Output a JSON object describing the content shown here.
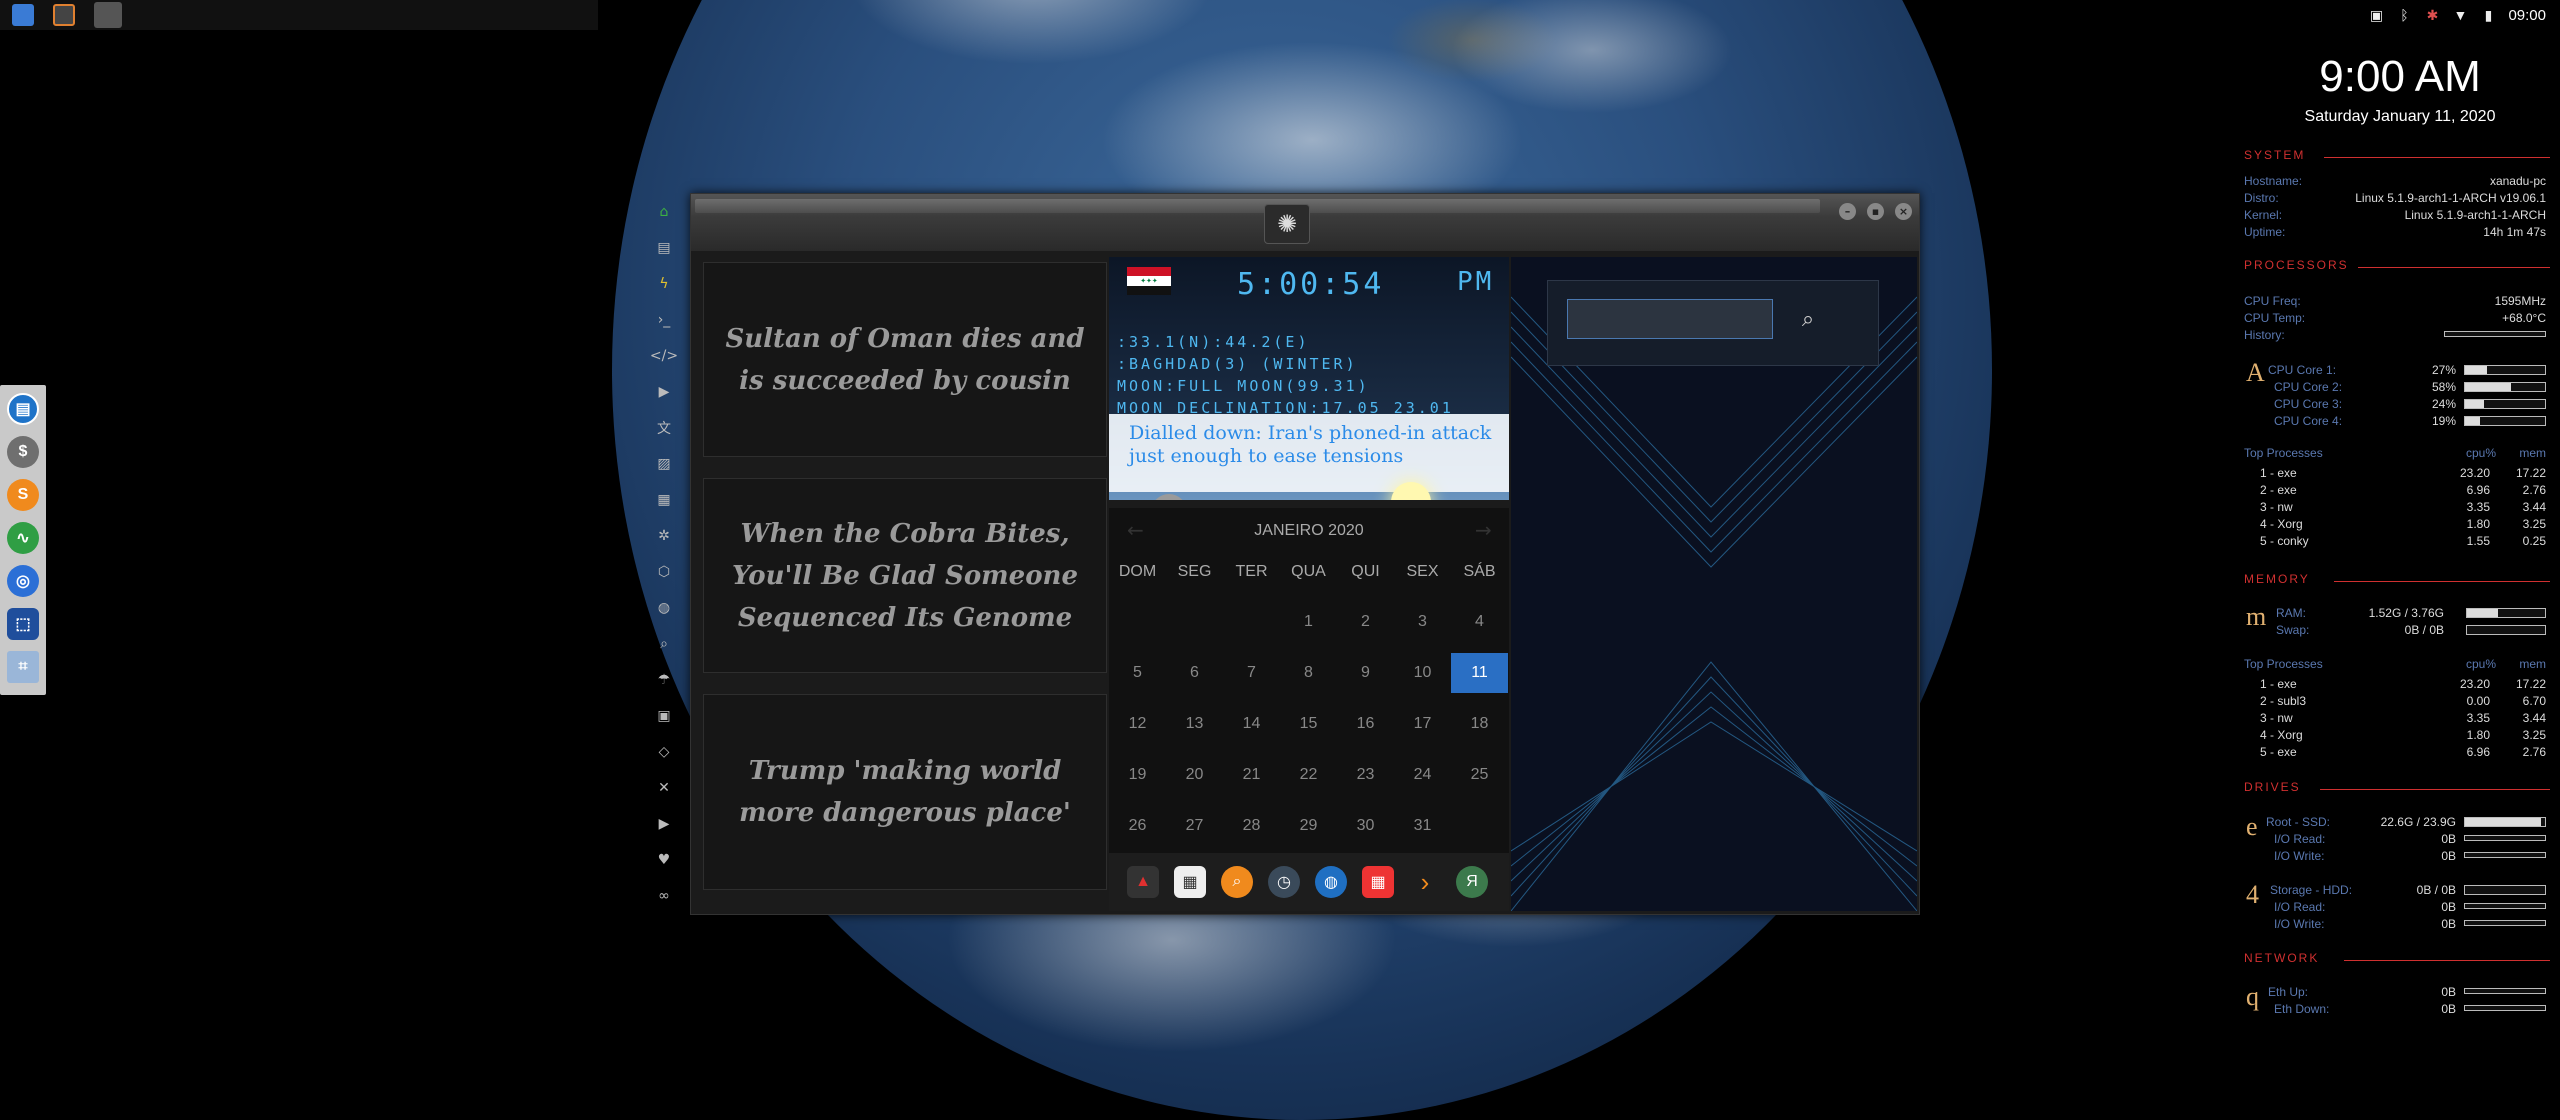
{
  "status_bar": {
    "clock": "09:00"
  },
  "clock_widget": {
    "time": "9:00 AM",
    "date": "Saturday January 11, 2020"
  },
  "news": [
    {
      "headline": "Sultan of Oman dies and is succeeded by cousin"
    },
    {
      "headline": "When the Cobra Bites, You'll Be Glad Someone Sequenced Its Genome"
    },
    {
      "headline": "Trump 'making world more dangerous place'"
    }
  ],
  "world_clock": {
    "time": "5:00:54",
    "ampm": "PM",
    "coords": ":33.1(N):44.2(E)",
    "city": ":BAGHDAD(3) (WINTER)",
    "moon": "MOON:FULL MOON(99.31)",
    "declination": "MOON DECLINATION:17.05 23.01"
  },
  "moon_headline": "Dialled down: Iran's phoned-in attack just enough to ease tensions",
  "calendar": {
    "month_label": "JANEIRO 2020",
    "weekdays": [
      "DOM",
      "SEG",
      "TER",
      "QUA",
      "QUI",
      "SEX",
      "SÁB"
    ],
    "weeks": [
      [
        "",
        "",
        "",
        "1",
        "2",
        "3",
        "4"
      ],
      [
        "5",
        "6",
        "7",
        "8",
        "9",
        "10",
        "11"
      ],
      [
        "12",
        "13",
        "14",
        "15",
        "16",
        "17",
        "18"
      ],
      [
        "19",
        "20",
        "21",
        "22",
        "23",
        "24",
        "25"
      ],
      [
        "26",
        "27",
        "28",
        "29",
        "30",
        "31",
        ""
      ]
    ],
    "selected": "11"
  },
  "search": {
    "value": ""
  },
  "conky": {
    "system": {
      "title": "SYSTEM",
      "rows": [
        {
          "label": "Hostname:",
          "value": "xanadu-pc"
        },
        {
          "label": "Distro:",
          "value": "Linux 5.1.9-arch1-1-ARCH v19.06.1"
        },
        {
          "label": "Kernel:",
          "value": "Linux 5.1.9-arch1-1-ARCH"
        },
        {
          "label": "Uptime:",
          "value": "14h 1m 47s"
        }
      ]
    },
    "processors": {
      "title": "PROCESSORS",
      "freq_label": "CPU Freq:",
      "freq": "1595MHz",
      "temp_label": "CPU Temp:",
      "temp": "+68.0°C",
      "history_label": "History:",
      "glyph": "A",
      "cores": [
        {
          "label": "CPU Core 1:",
          "value": "27%",
          "pct": 27
        },
        {
          "label": "CPU Core 2:",
          "value": "58%",
          "pct": 58
        },
        {
          "label": "CPU Core 3:",
          "value": "24%",
          "pct": 24
        },
        {
          "label": "CPU Core 4:",
          "value": "19%",
          "pct": 19
        }
      ],
      "top_title": "Top Processes",
      "col_cpu": "cpu%",
      "col_mem": "mem",
      "top": [
        {
          "name": "1 - exe",
          "cpu": "23.20",
          "mem": "17.22"
        },
        {
          "name": "2 - exe",
          "cpu": "6.96",
          "mem": "2.76"
        },
        {
          "name": "3 - nw",
          "cpu": "3.35",
          "mem": "3.44"
        },
        {
          "name": "4 - Xorg",
          "cpu": "1.80",
          "mem": "3.25"
        },
        {
          "name": "5 - conky",
          "cpu": "1.55",
          "mem": "0.25"
        }
      ]
    },
    "memory": {
      "title": "MEMORY",
      "glyph": "m",
      "ram_label": "RAM:",
      "ram": "1.52G / 3.76G",
      "ram_pct": 40,
      "swap_label": "Swap:",
      "swap": "0B / 0B",
      "swap_pct": 0,
      "top_title": "Top Processes",
      "col_cpu": "cpu%",
      "col_mem": "mem",
      "top": [
        {
          "name": "1 - exe",
          "cpu": "23.20",
          "mem": "17.22"
        },
        {
          "name": "2 - subl3",
          "cpu": "0.00",
          "mem": "6.70"
        },
        {
          "name": "3 - nw",
          "cpu": "3.35",
          "mem": "3.44"
        },
        {
          "name": "4 - Xorg",
          "cpu": "1.80",
          "mem": "3.25"
        },
        {
          "name": "5 - exe",
          "cpu": "6.96",
          "mem": "2.76"
        }
      ]
    },
    "drives": {
      "title": "DRIVES",
      "root": {
        "glyph": "e",
        "label": "Root - SSD:",
        "value": "22.6G / 23.9G",
        "pct": 95,
        "read_label": "I/O Read:",
        "read": "0B",
        "write_label": "I/O Write:",
        "write": "0B"
      },
      "storage": {
        "glyph": "4",
        "label": "Storage - HDD:",
        "value": "0B / 0B",
        "pct": 0,
        "read_label": "I/O Read:",
        "read": "0B",
        "write_label": "I/O Write:",
        "write": "0B"
      }
    },
    "network": {
      "title": "NETWORK",
      "glyph": "q",
      "up_label": "Eth Up:",
      "up": "0B",
      "down_label": "Eth Down:",
      "down": "0B"
    }
  }
}
